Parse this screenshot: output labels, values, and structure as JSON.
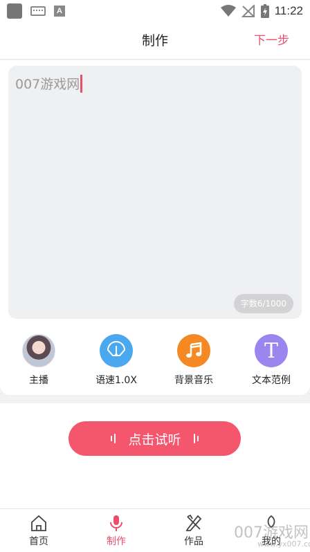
{
  "status_bar": {
    "time": "11:22"
  },
  "header": {
    "title": "制作",
    "next_label": "下一步"
  },
  "editor": {
    "text": "007游戏网",
    "char_count": "字数6/1000"
  },
  "tools": [
    {
      "label": "主播",
      "icon": "avatar"
    },
    {
      "label": "语速1.0X",
      "icon": "speedometer-icon"
    },
    {
      "label": "背景音乐",
      "icon": "music-note-icon"
    },
    {
      "label": "文本范例",
      "icon": "text-t-icon",
      "glyph": "T"
    }
  ],
  "listen_button": {
    "label": "点击试听"
  },
  "bottom_nav": [
    {
      "label": "首页",
      "icon": "home-icon",
      "active": false
    },
    {
      "label": "制作",
      "icon": "microphone-icon",
      "active": true
    },
    {
      "label": "作品",
      "icon": "works-icon",
      "active": false
    },
    {
      "label": "我的",
      "icon": "profile-icon",
      "active": false
    }
  ],
  "watermark": {
    "text": "007游戏网",
    "url": "www.yx007.com"
  },
  "colors": {
    "accent": "#f4566e",
    "speed": "#4aa8ee",
    "music": "#f58a25",
    "text": "#9b86f0"
  }
}
